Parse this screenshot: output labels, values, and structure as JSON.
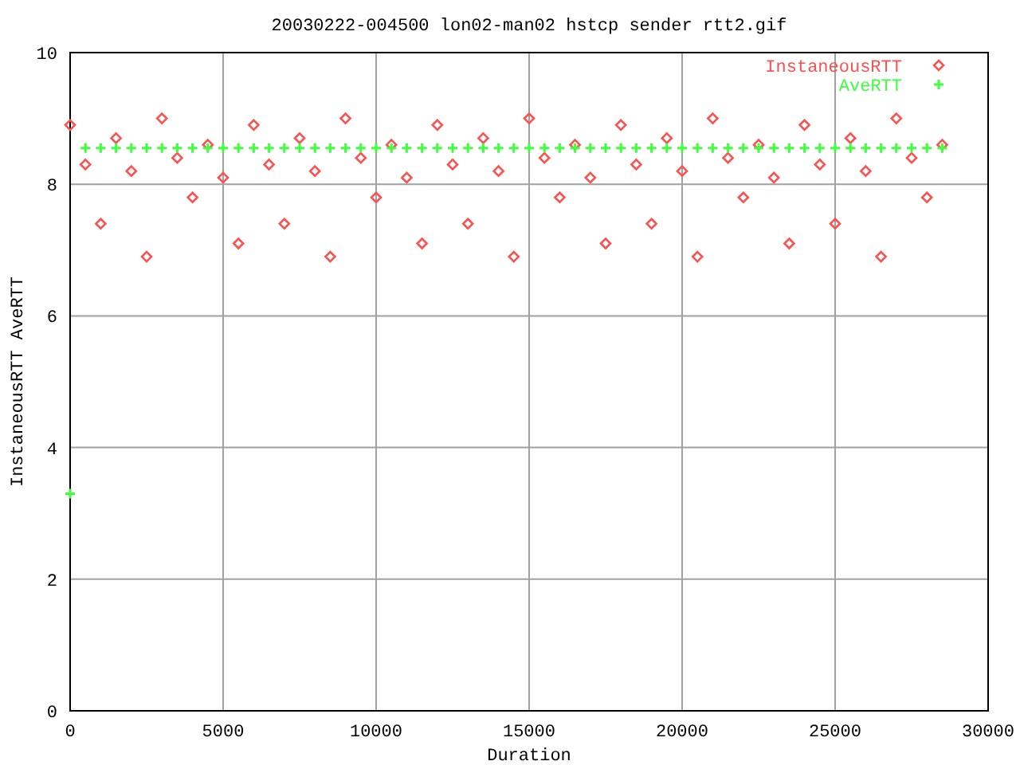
{
  "chart_data": {
    "type": "scatter",
    "title": "20030222-004500 lon02-man02 hstcp sender rtt2.gif",
    "xlabel": "Duration",
    "ylabel": "InstaneousRTT AveRTT",
    "x": [
      0,
      500,
      1000,
      1500,
      2000,
      2500,
      3000,
      3500,
      4000,
      4500,
      5000,
      5500,
      6000,
      6500,
      7000,
      7500,
      8000,
      8500,
      9000,
      9500,
      10000,
      10500,
      11000,
      11500,
      12000,
      12500,
      13000,
      13500,
      14000,
      14500,
      15000,
      15500,
      16000,
      16500,
      17000,
      17500,
      18000,
      18500,
      19000,
      19500,
      20000,
      20500,
      21000,
      21500,
      22000,
      22500,
      23000,
      23500,
      24000,
      24500,
      25000,
      25500,
      26000,
      26500,
      27000,
      27500,
      28000,
      28500
    ],
    "series": [
      {
        "name": "InstaneousRTT",
        "color": "#ff5050",
        "values": [
          8.9,
          8.3,
          7.4,
          8.7,
          8.2,
          6.9,
          9.0,
          8.4,
          7.8,
          8.6,
          8.1,
          7.1,
          8.9,
          8.3,
          7.4,
          8.7,
          8.2,
          6.9,
          9.0,
          8.4,
          7.8,
          8.6,
          8.1,
          7.1,
          8.9,
          8.3,
          7.4,
          8.7,
          8.2,
          6.9,
          9.0,
          8.4,
          7.8,
          8.6,
          8.1,
          7.1,
          8.9,
          8.3,
          7.4,
          8.7,
          8.2,
          6.9,
          9.0,
          8.4,
          7.8,
          8.6,
          8.1,
          7.1,
          8.9,
          8.3,
          7.4,
          8.7,
          8.2,
          6.9,
          9.0,
          8.4,
          7.8,
          8.6
        ]
      },
      {
        "name": "AveRTT",
        "color": "#40ff40",
        "values": [
          3.3,
          8.55,
          8.55,
          8.55,
          8.55,
          8.55,
          8.55,
          8.55,
          8.55,
          8.55,
          8.55,
          8.55,
          8.55,
          8.55,
          8.55,
          8.55,
          8.55,
          8.55,
          8.55,
          8.55,
          8.55,
          8.55,
          8.55,
          8.55,
          8.55,
          8.55,
          8.55,
          8.55,
          8.55,
          8.55,
          8.55,
          8.55,
          8.55,
          8.55,
          8.55,
          8.55,
          8.55,
          8.55,
          8.55,
          8.55,
          8.55,
          8.55,
          8.55,
          8.55,
          8.55,
          8.55,
          8.55,
          8.55,
          8.55,
          8.55,
          8.55,
          8.55,
          8.55,
          8.55,
          8.55,
          8.55,
          8.55,
          8.55
        ]
      }
    ],
    "xlim": [
      0,
      30000
    ],
    "ylim": [
      0,
      10
    ],
    "xticks": [
      0,
      5000,
      10000,
      15000,
      20000,
      25000,
      30000
    ],
    "yticks": [
      0,
      2,
      4,
      6,
      8,
      10
    ],
    "grid": true,
    "legend": true
  }
}
